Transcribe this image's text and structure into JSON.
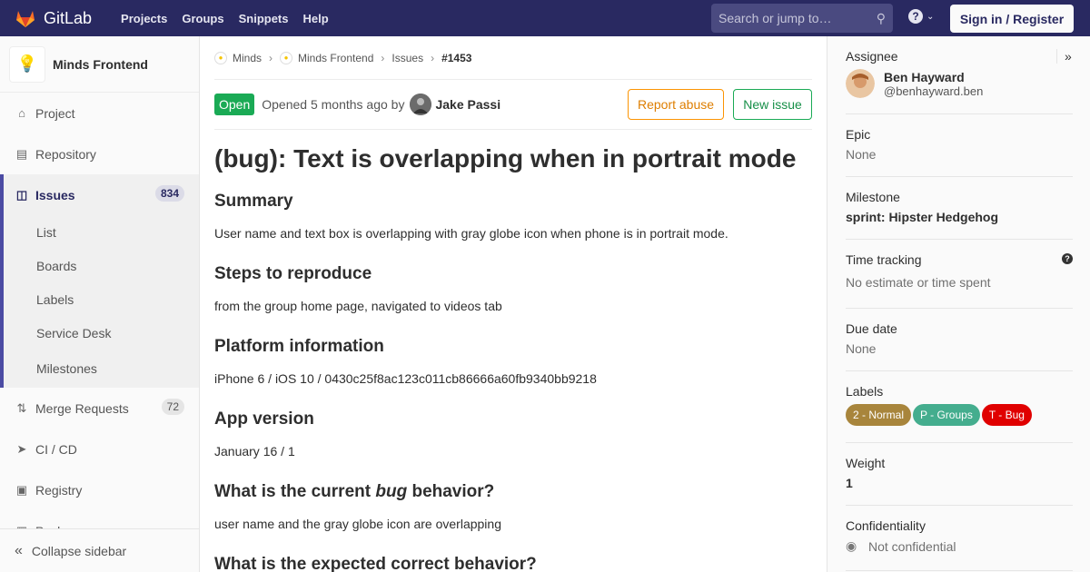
{
  "topbar": {
    "brand": "GitLab",
    "nav": [
      "Projects",
      "Groups",
      "Snippets",
      "Help"
    ],
    "search_placeholder": "Search or jump to…",
    "sign_in": "Sign in / Register"
  },
  "sidebar": {
    "project_name": "Minds Frontend",
    "items": {
      "project": "Project",
      "repository": "Repository",
      "issues": "Issues",
      "issues_count": "834",
      "merge_requests": "Merge Requests",
      "mr_count": "72",
      "cicd": "CI / CD",
      "registry": "Registry",
      "packages": "Packages"
    },
    "sub_items": [
      "List",
      "Boards",
      "Labels",
      "Service Desk",
      "Milestones"
    ],
    "collapse": "Collapse sidebar"
  },
  "breadcrumb": {
    "group": "Minds",
    "project": "Minds Frontend",
    "section": "Issues",
    "current": "#1453"
  },
  "issue": {
    "status": "Open",
    "opened": "Opened 5 months ago by",
    "author": "Jake Passi",
    "report_abuse": "Report abuse",
    "new_issue": "New issue",
    "title": "(bug): Text is overlapping when in portrait mode",
    "summary_h": "Summary",
    "summary": "User name and text box is overlapping with gray globe icon when phone is in portrait mode.",
    "steps_h": "Steps to reproduce",
    "steps": "from the group home page, navigated to videos tab",
    "platform_h": "Platform information",
    "platform": "iPhone 6 / iOS 10 / 0430c25f8ac123c011cb86666a60fb9340bb9218",
    "app_h": "App version",
    "app": "January 16 / 1",
    "current_h_pre": "What is the current ",
    "current_h_em": "bug",
    "current_h_post": " behavior?",
    "current": "user name and the gray globe icon are overlapping",
    "expected_h": "What is the expected correct behavior?"
  },
  "right_sidebar": {
    "assignee_t": "Assignee",
    "assignee_name": "Ben Hayward",
    "assignee_handle": "@benhayward.ben",
    "epic_t": "Epic",
    "epic": "None",
    "milestone_t": "Milestone",
    "milestone": "sprint: Hipster Hedgehog",
    "time_t": "Time tracking",
    "time": "No estimate or time spent",
    "due_t": "Due date",
    "due": "None",
    "labels_t": "Labels",
    "labels": [
      {
        "name": "2 - Normal",
        "color": "#a8853c"
      },
      {
        "name": "P - Groups",
        "color": "#44ad8e"
      },
      {
        "name": "T - Bug",
        "color": "#e00000"
      }
    ],
    "weight_t": "Weight",
    "weight": "1",
    "conf_t": "Confidentiality",
    "conf": "Not confidential"
  }
}
